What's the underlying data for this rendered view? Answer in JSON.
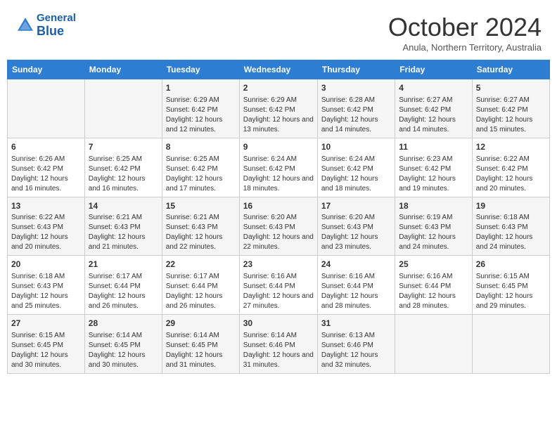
{
  "header": {
    "logo": {
      "general": "General",
      "blue": "Blue"
    },
    "title": "October 2024",
    "subtitle": "Anula, Northern Territory, Australia"
  },
  "calendar": {
    "days_of_week": [
      "Sunday",
      "Monday",
      "Tuesday",
      "Wednesday",
      "Thursday",
      "Friday",
      "Saturday"
    ],
    "weeks": [
      [
        {
          "day": "",
          "info": ""
        },
        {
          "day": "",
          "info": ""
        },
        {
          "day": "1",
          "info": "Sunrise: 6:29 AM\nSunset: 6:42 PM\nDaylight: 12 hours and 12 minutes."
        },
        {
          "day": "2",
          "info": "Sunrise: 6:29 AM\nSunset: 6:42 PM\nDaylight: 12 hours and 13 minutes."
        },
        {
          "day": "3",
          "info": "Sunrise: 6:28 AM\nSunset: 6:42 PM\nDaylight: 12 hours and 14 minutes."
        },
        {
          "day": "4",
          "info": "Sunrise: 6:27 AM\nSunset: 6:42 PM\nDaylight: 12 hours and 14 minutes."
        },
        {
          "day": "5",
          "info": "Sunrise: 6:27 AM\nSunset: 6:42 PM\nDaylight: 12 hours and 15 minutes."
        }
      ],
      [
        {
          "day": "6",
          "info": "Sunrise: 6:26 AM\nSunset: 6:42 PM\nDaylight: 12 hours and 16 minutes."
        },
        {
          "day": "7",
          "info": "Sunrise: 6:25 AM\nSunset: 6:42 PM\nDaylight: 12 hours and 16 minutes."
        },
        {
          "day": "8",
          "info": "Sunrise: 6:25 AM\nSunset: 6:42 PM\nDaylight: 12 hours and 17 minutes."
        },
        {
          "day": "9",
          "info": "Sunrise: 6:24 AM\nSunset: 6:42 PM\nDaylight: 12 hours and 18 minutes."
        },
        {
          "day": "10",
          "info": "Sunrise: 6:24 AM\nSunset: 6:42 PM\nDaylight: 12 hours and 18 minutes."
        },
        {
          "day": "11",
          "info": "Sunrise: 6:23 AM\nSunset: 6:42 PM\nDaylight: 12 hours and 19 minutes."
        },
        {
          "day": "12",
          "info": "Sunrise: 6:22 AM\nSunset: 6:42 PM\nDaylight: 12 hours and 20 minutes."
        }
      ],
      [
        {
          "day": "13",
          "info": "Sunrise: 6:22 AM\nSunset: 6:43 PM\nDaylight: 12 hours and 20 minutes."
        },
        {
          "day": "14",
          "info": "Sunrise: 6:21 AM\nSunset: 6:43 PM\nDaylight: 12 hours and 21 minutes."
        },
        {
          "day": "15",
          "info": "Sunrise: 6:21 AM\nSunset: 6:43 PM\nDaylight: 12 hours and 22 minutes."
        },
        {
          "day": "16",
          "info": "Sunrise: 6:20 AM\nSunset: 6:43 PM\nDaylight: 12 hours and 22 minutes."
        },
        {
          "day": "17",
          "info": "Sunrise: 6:20 AM\nSunset: 6:43 PM\nDaylight: 12 hours and 23 minutes."
        },
        {
          "day": "18",
          "info": "Sunrise: 6:19 AM\nSunset: 6:43 PM\nDaylight: 12 hours and 24 minutes."
        },
        {
          "day": "19",
          "info": "Sunrise: 6:18 AM\nSunset: 6:43 PM\nDaylight: 12 hours and 24 minutes."
        }
      ],
      [
        {
          "day": "20",
          "info": "Sunrise: 6:18 AM\nSunset: 6:43 PM\nDaylight: 12 hours and 25 minutes."
        },
        {
          "day": "21",
          "info": "Sunrise: 6:17 AM\nSunset: 6:44 PM\nDaylight: 12 hours and 26 minutes."
        },
        {
          "day": "22",
          "info": "Sunrise: 6:17 AM\nSunset: 6:44 PM\nDaylight: 12 hours and 26 minutes."
        },
        {
          "day": "23",
          "info": "Sunrise: 6:16 AM\nSunset: 6:44 PM\nDaylight: 12 hours and 27 minutes."
        },
        {
          "day": "24",
          "info": "Sunrise: 6:16 AM\nSunset: 6:44 PM\nDaylight: 12 hours and 28 minutes."
        },
        {
          "day": "25",
          "info": "Sunrise: 6:16 AM\nSunset: 6:44 PM\nDaylight: 12 hours and 28 minutes."
        },
        {
          "day": "26",
          "info": "Sunrise: 6:15 AM\nSunset: 6:45 PM\nDaylight: 12 hours and 29 minutes."
        }
      ],
      [
        {
          "day": "27",
          "info": "Sunrise: 6:15 AM\nSunset: 6:45 PM\nDaylight: 12 hours and 30 minutes."
        },
        {
          "day": "28",
          "info": "Sunrise: 6:14 AM\nSunset: 6:45 PM\nDaylight: 12 hours and 30 minutes."
        },
        {
          "day": "29",
          "info": "Sunrise: 6:14 AM\nSunset: 6:45 PM\nDaylight: 12 hours and 31 minutes."
        },
        {
          "day": "30",
          "info": "Sunrise: 6:14 AM\nSunset: 6:46 PM\nDaylight: 12 hours and 31 minutes."
        },
        {
          "day": "31",
          "info": "Sunrise: 6:13 AM\nSunset: 6:46 PM\nDaylight: 12 hours and 32 minutes."
        },
        {
          "day": "",
          "info": ""
        },
        {
          "day": "",
          "info": ""
        }
      ]
    ]
  }
}
